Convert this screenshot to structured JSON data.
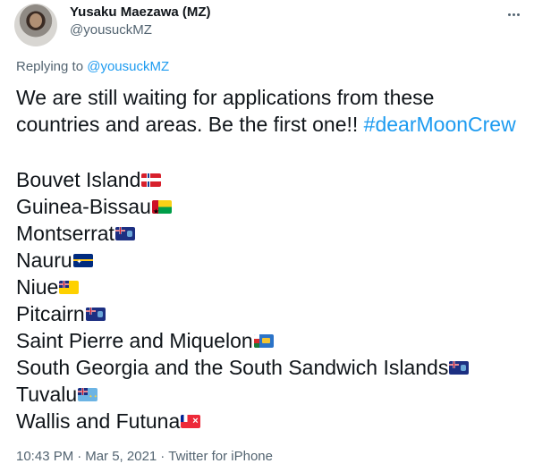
{
  "author": {
    "display_name": "Yusaku Maezawa (MZ)",
    "handle": "@yousuckMZ"
  },
  "reply": {
    "prefix": "Replying to ",
    "mention": "@yousuckMZ"
  },
  "tweet": {
    "text_line1": "We are still waiting for applications from these",
    "text_line2": "countries and areas. Be the first one!! ",
    "hashtag": "#dearMoonCrew",
    "list": [
      {
        "name": "Bouvet Island",
        "flag": "flag-icon-norway"
      },
      {
        "name": "Guinea-Bissau",
        "flag": "flag-icon-guinea-bissau"
      },
      {
        "name": "Montserrat",
        "flag": "flag-icon-montserrat"
      },
      {
        "name": "Nauru",
        "flag": "flag-icon-nauru"
      },
      {
        "name": "Niue",
        "flag": "flag-icon-niue"
      },
      {
        "name": "Pitcairn",
        "flag": "flag-icon-pitcairn"
      },
      {
        "name": "Saint Pierre and Miquelon",
        "flag": "flag-icon-saint-pierre-miquelon"
      },
      {
        "name": "South Georgia and the South Sandwich Islands",
        "flag": "flag-icon-south-georgia"
      },
      {
        "name": "Tuvalu",
        "flag": "flag-icon-tuvalu"
      },
      {
        "name": "Wallis and Futuna",
        "flag": "flag-icon-wallis-futuna"
      }
    ]
  },
  "meta": {
    "time": "10:43 PM",
    "separator1": "·",
    "date": "Mar 5, 2021",
    "separator2": "·",
    "source": "Twitter for iPhone"
  },
  "icons": {
    "more": "more-icon"
  },
  "colors": {
    "link": "#1d9bf0",
    "secondary_text": "#536471",
    "primary_text": "#0f1419"
  }
}
